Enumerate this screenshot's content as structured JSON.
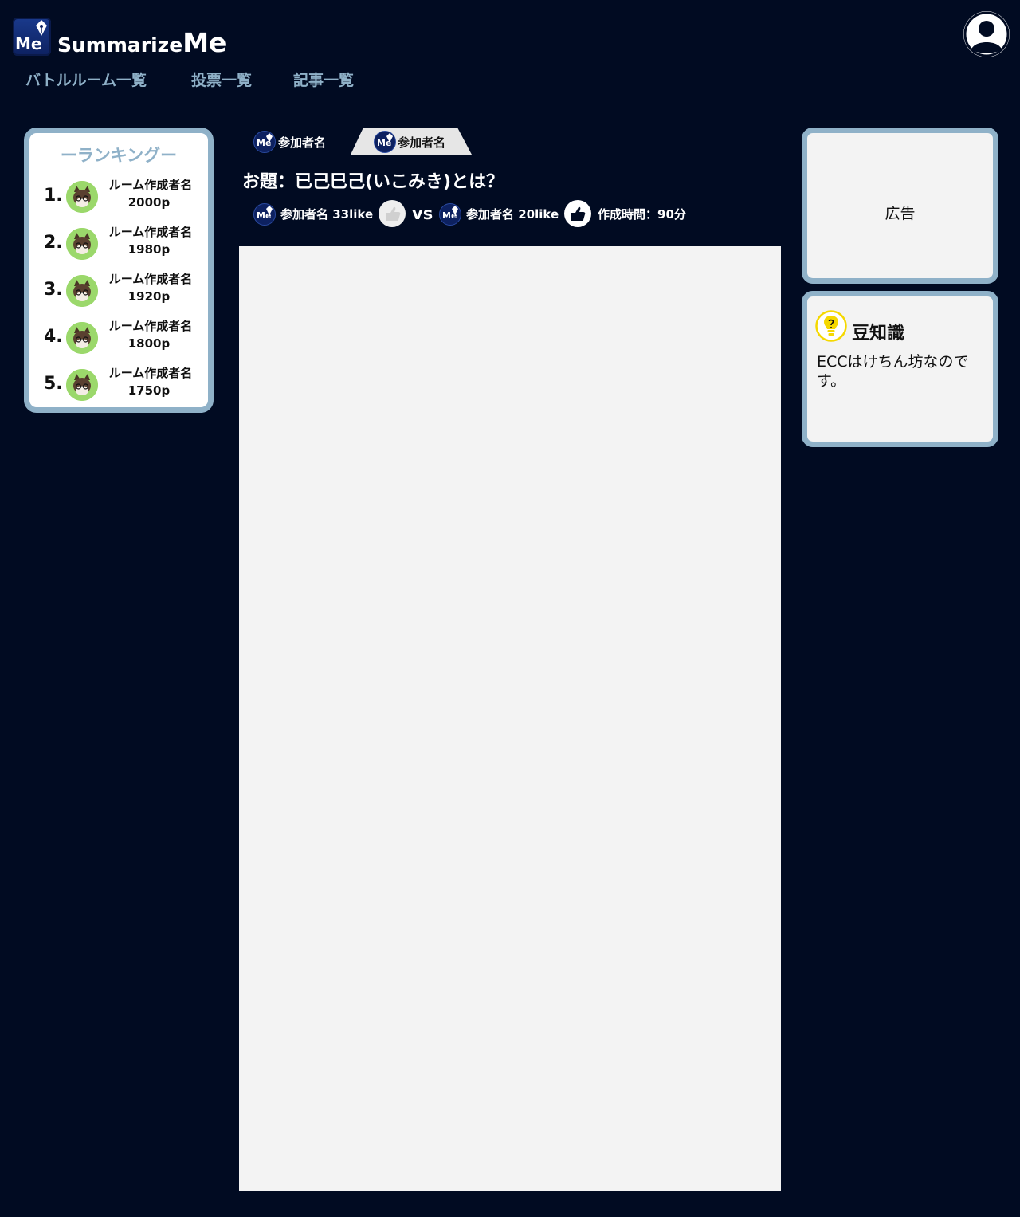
{
  "header": {
    "brand_prefix": "Summarize",
    "brand_suffix": "Me",
    "logo_text": "Me",
    "nav": [
      "バトルルーム一覧",
      "投票一覧",
      "記事一覧"
    ]
  },
  "ranking": {
    "title": "ーランキングー",
    "items": [
      {
        "rank": "1.",
        "name": "ルーム作成者名",
        "points": "2000p"
      },
      {
        "rank": "2.",
        "name": "ルーム作成者名",
        "points": "1980p"
      },
      {
        "rank": "3.",
        "name": "ルーム作成者名",
        "points": "1920p"
      },
      {
        "rank": "4.",
        "name": "ルーム作成者名",
        "points": "1800p"
      },
      {
        "rank": "5.",
        "name": "ルーム作成者名",
        "points": "1750p"
      }
    ]
  },
  "battle": {
    "tabs": [
      {
        "label": "参加者名",
        "active": false
      },
      {
        "label": "参加者名",
        "active": true
      }
    ],
    "topic": "お題：已己巳己(いこみき)とは？",
    "left": {
      "name_likes": "参加者名 33like"
    },
    "vs": "vs",
    "right": {
      "name_likes": "参加者名 20like"
    },
    "time": "作成時間：90分"
  },
  "sidebar": {
    "ad_label": "広告",
    "trivia_title": "豆知識",
    "trivia_text": "ECCはけちん坊なのです。"
  },
  "colors": {
    "background": "#010b22",
    "accent": "#8fb1c8",
    "panel": "#f3f3f3",
    "logo_blue": "#0d2160"
  }
}
